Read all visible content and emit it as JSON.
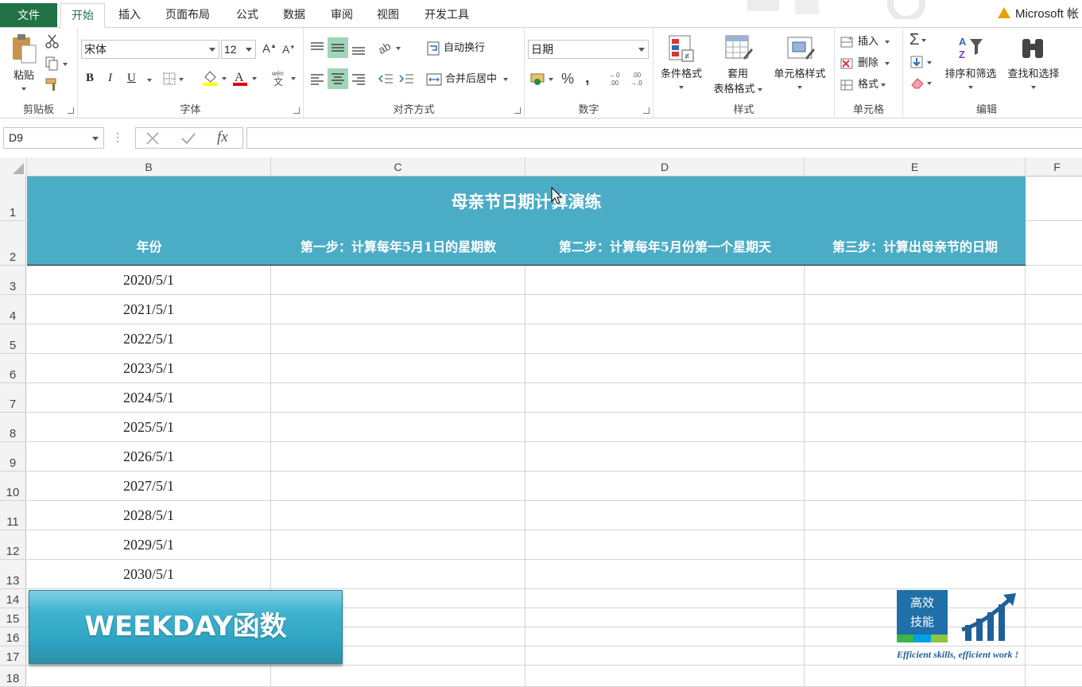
{
  "tabs": {
    "file": "文件",
    "items": [
      "开始",
      "插入",
      "页面布局",
      "公式",
      "数据",
      "审阅",
      "视图",
      "开发工具"
    ],
    "active": "开始",
    "account": "Microsoft 帐"
  },
  "ribbon": {
    "clipboard": {
      "paste": "粘贴",
      "label": "剪贴板"
    },
    "font": {
      "name": "宋体",
      "size": "12",
      "bold": "B",
      "italic": "I",
      "underline": "U",
      "label": "字体"
    },
    "alignment": {
      "wrap": "自动换行",
      "merge": "合并后居中",
      "label": "对齐方式"
    },
    "number": {
      "format": "日期",
      "percent": "%",
      "comma": ",",
      "label": "数字"
    },
    "styles": {
      "conditional": "条件格式",
      "table1": "套用",
      "table2": "表格格式",
      "cell": "单元格样式",
      "label": "样式"
    },
    "cells": {
      "insert": "插入",
      "delete": "删除",
      "format": "格式",
      "label": "单元格"
    },
    "editing": {
      "sigma": "Σ",
      "sort": "排序和筛选",
      "find": "查找和选择",
      "label": "编辑"
    }
  },
  "formula_bar": {
    "name_box": "D9",
    "fx": "fx",
    "value": ""
  },
  "columns": [
    "B",
    "C",
    "D",
    "E",
    "F"
  ],
  "rows": [
    "1",
    "2",
    "3",
    "4",
    "5",
    "6",
    "7",
    "8",
    "9",
    "10",
    "11",
    "12",
    "13",
    "14",
    "15",
    "16",
    "17",
    "18"
  ],
  "sheet": {
    "title": "母亲节日期计算演练",
    "headers": [
      "年份",
      "第一步：计算每年5月1日的星期数",
      "第二步：计算每年5月份第一个星期天",
      "第三步：计算出母亲节的日期"
    ],
    "years": [
      "2020/5/1",
      "2021/5/1",
      "2022/5/1",
      "2023/5/1",
      "2024/5/1",
      "2025/5/1",
      "2026/5/1",
      "2027/5/1",
      "2028/5/1",
      "2029/5/1",
      "2030/5/1"
    ]
  },
  "button": {
    "label": "WEEKDAY函数"
  },
  "logo": {
    "line1": "高效",
    "line2": "技能",
    "tagline": "Efficient skills, efficient work !",
    "colors": [
      "#39b54a",
      "#00a0e9",
      "#8dc63f"
    ]
  },
  "colors": {
    "ribbon_accent": "#217346",
    "header_fill": "#4bacc6",
    "logo_blue": "#1f6fa8"
  }
}
